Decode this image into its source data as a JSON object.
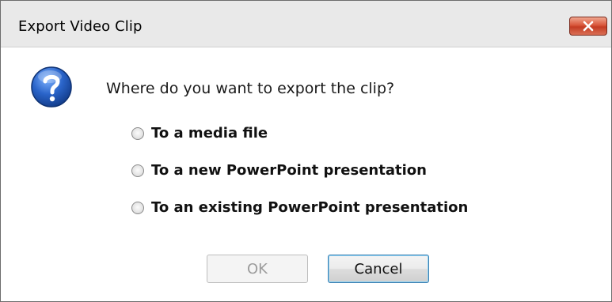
{
  "dialog": {
    "title": "Export Video Clip",
    "close_icon": "close-x-icon",
    "question_icon": "question-icon",
    "prompt": "Where do you want to export the clip?",
    "options": [
      {
        "label": "To a media file",
        "selected": false
      },
      {
        "label": "To a new PowerPoint presentation",
        "selected": false
      },
      {
        "label": "To an existing PowerPoint presentation",
        "selected": false
      }
    ],
    "buttons": {
      "ok_label": "OK",
      "ok_enabled": false,
      "cancel_label": "Cancel"
    }
  },
  "colors": {
    "close_button": "#d9573b",
    "question_icon_blue": "#1f57b8",
    "default_button_border": "#3c7fb1",
    "disabled_text": "#9b9b9b"
  }
}
